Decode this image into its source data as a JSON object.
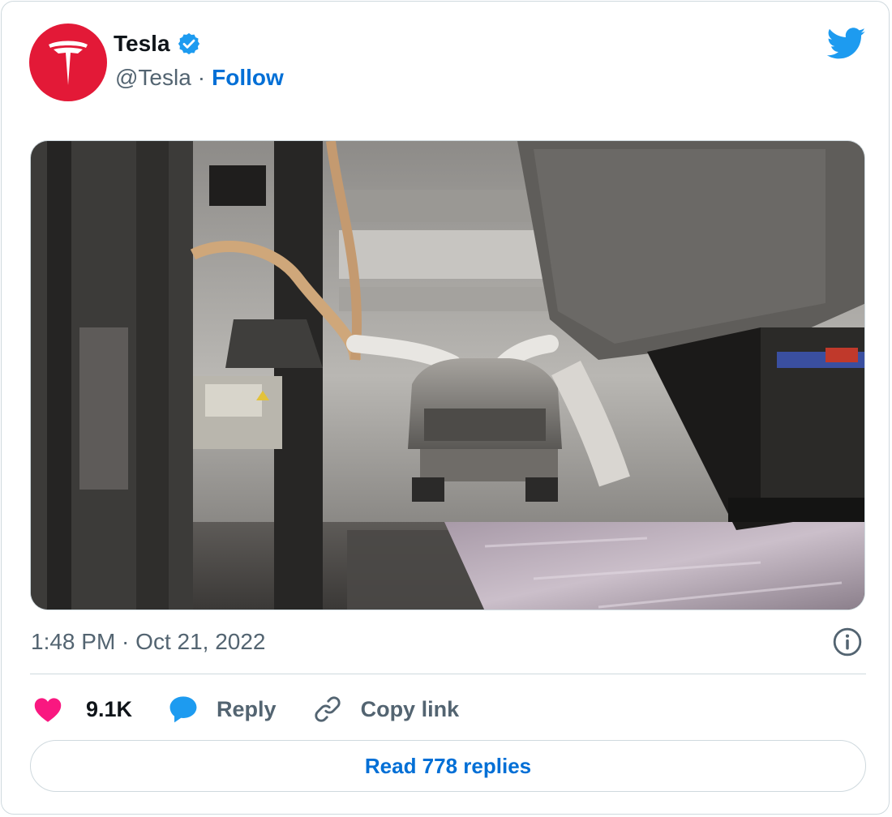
{
  "author": {
    "name": "Tesla",
    "handle": "@Tesla",
    "separator": "·",
    "follow_label": "Follow",
    "avatar_color": "#e31937",
    "verified_color": "#1d9bf0"
  },
  "icons": {
    "brand": "twitter-bird-icon",
    "verified": "verified-badge-icon",
    "info": "info-icon",
    "like": "heart-icon",
    "reply": "speech-bubble-icon",
    "copy": "link-icon"
  },
  "tweet": {
    "timestamp": "1:48 PM · Oct 21, 2022"
  },
  "actions": {
    "likes_count": "9.1K",
    "reply_label": "Reply",
    "copy_link_label": "Copy link"
  },
  "footer": {
    "read_replies_label": "Read 778 replies"
  },
  "colors": {
    "accent": "#006fd6",
    "like": "#f91880",
    "brand_bird": "#1d9bf0",
    "text_secondary": "#536471",
    "border": "#cfd9de"
  }
}
